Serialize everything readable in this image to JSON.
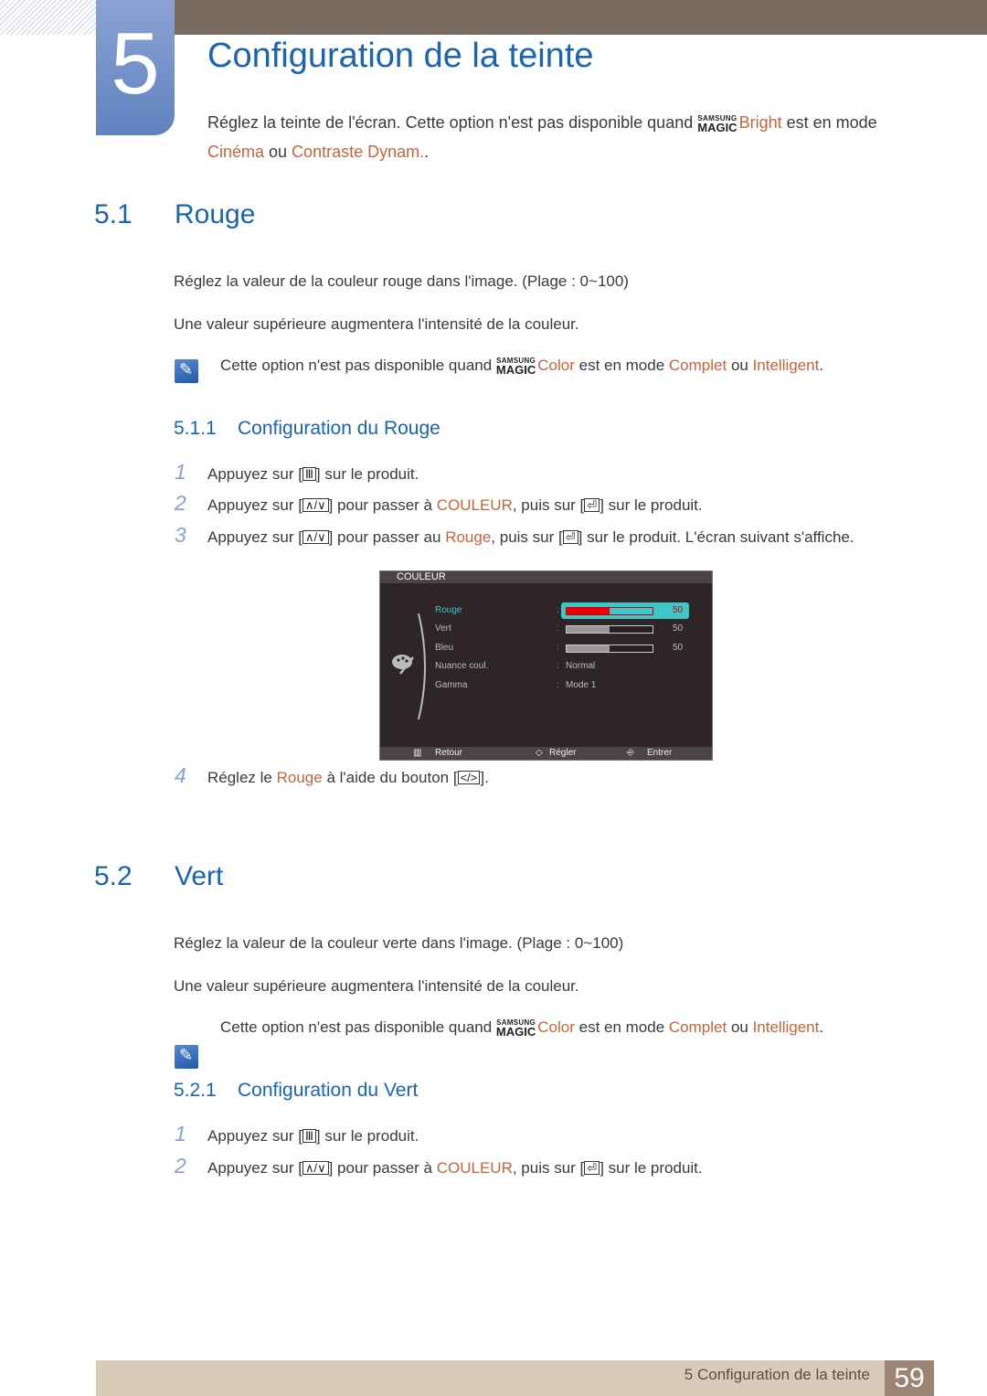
{
  "chapter": {
    "number": "5",
    "title": "Configuration de la teinte",
    "intro_before": "Réglez la teinte de l'écran. Cette option n'est pas disponible quand ",
    "magic_top": "SAMSUNG",
    "magic_bottom": "MAGIC",
    "intro_link1": "Bright",
    "intro_mid": " est en mode",
    "intro_link2": "Cinéma",
    "intro_or": " ou ",
    "intro_link3": "Contraste Dynam.",
    "intro_end": "."
  },
  "s51": {
    "number": "5.1",
    "title": "Rouge",
    "p1": "Réglez la valeur de la couleur rouge dans l'image. (Plage : 0~100)",
    "p2": "Une valeur supérieure augmentera l'intensité de la couleur.",
    "note_before": "Cette option n'est pas disponible quand ",
    "note_link1": "Color",
    "note_mid": " est en mode ",
    "note_link2": "Complet",
    "note_or": " ou ",
    "note_link3": "Intelligent",
    "note_end": ".",
    "sub": {
      "number": "5.1.1",
      "title": "Configuration du Rouge",
      "steps": [
        {
          "n": "1",
          "a": "Appuyez sur [",
          "key": "Ⅲ",
          "b": "] sur le produit."
        },
        {
          "n": "2",
          "a": "Appuyez sur [",
          "key": "∧/∨",
          "b": "] pour passer à ",
          "link": "COULEUR",
          "c": ", puis sur [",
          "key2": "⏎",
          "d": "] sur le produit."
        },
        {
          "n": "3",
          "a": "Appuyez sur [",
          "key": "∧/∨",
          "b": "] pour passer au ",
          "link": "Rouge",
          "c": ", puis sur [",
          "key2": "⏎",
          "d": "] sur le produit. L'écran suivant s'affiche."
        },
        {
          "n": "4",
          "a": "Réglez le ",
          "link": "Rouge",
          "b": " à l'aide du bouton [",
          "key": "</>",
          "c": "]."
        }
      ]
    }
  },
  "osd": {
    "title": "COULEUR",
    "items": [
      {
        "label": "Rouge",
        "value": 50,
        "type": "bar",
        "selected": true
      },
      {
        "label": "Vert",
        "value": 50,
        "type": "bar"
      },
      {
        "label": "Bleu",
        "value": 50,
        "type": "bar"
      },
      {
        "label": "Nuance coul.",
        "value": "Normal",
        "type": "text"
      },
      {
        "label": "Gamma",
        "value": "Mode 1",
        "type": "text"
      }
    ],
    "footer": {
      "back": "Retour",
      "adjust": "Régler",
      "enter": "Entrer"
    },
    "sep": ":"
  },
  "s52": {
    "number": "5.2",
    "title": "Vert",
    "p1": "Réglez la valeur de la couleur verte dans l'image. (Plage : 0~100)",
    "p2": "Une valeur supérieure augmentera l'intensité de la couleur.",
    "sub": {
      "number": "5.2.1",
      "title": "Configuration du Vert",
      "steps": [
        {
          "n": "1",
          "a": "Appuyez sur [",
          "key": "Ⅲ",
          "b": "] sur le produit."
        },
        {
          "n": "2",
          "a": "Appuyez sur [",
          "key": "∧/∨",
          "b": "] pour passer à ",
          "link": "COULEUR",
          "c": ", puis sur [",
          "key2": "⏎",
          "d": "] sur le produit."
        }
      ]
    }
  },
  "footer": {
    "text": "5 Configuration de la teinte",
    "page": "59"
  }
}
